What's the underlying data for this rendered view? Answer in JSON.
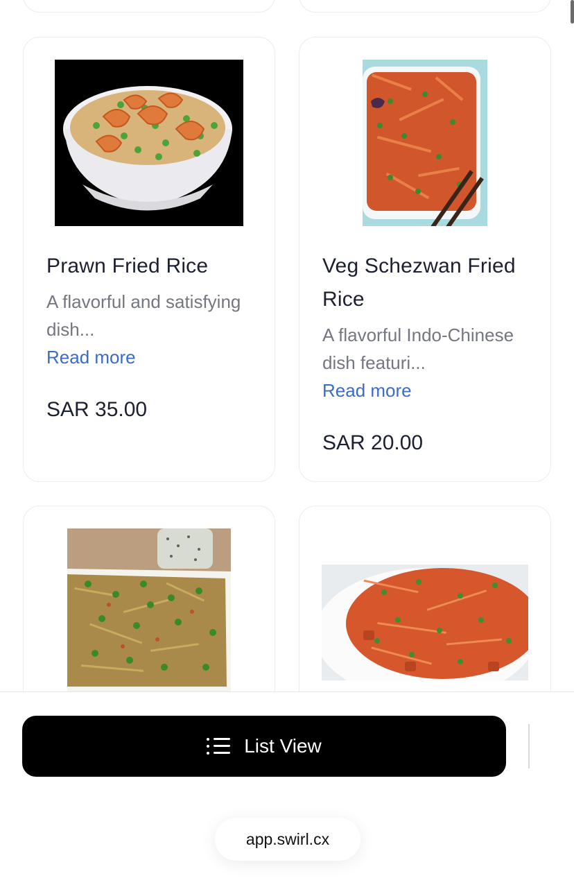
{
  "products": [
    {
      "title": "Prawn Fried Rice",
      "description": "A flavorful and satisfying dish...",
      "read_more": "Read more",
      "price": "SAR 35.00"
    },
    {
      "title": "Veg Schezwan Fried Rice",
      "description": "A flavorful Indo-Chinese dish featuri...",
      "read_more": "Read more",
      "price": "SAR 20.00"
    }
  ],
  "bottom_bar": {
    "list_view_label": "List View",
    "list_view_icon": "list-icon",
    "url": "app.swirl.cx"
  },
  "colors": {
    "link": "#3b6bc8",
    "button_bg": "#000000",
    "text_primary": "#1d2030",
    "text_secondary": "#757780"
  }
}
